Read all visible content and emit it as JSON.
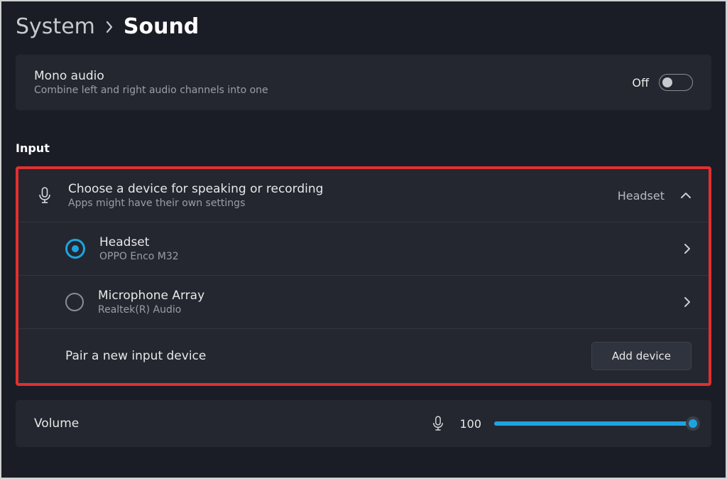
{
  "breadcrumb": {
    "system": "System",
    "sound": "Sound"
  },
  "monoAudio": {
    "title": "Mono audio",
    "sub": "Combine left and right audio channels into one",
    "stateLabel": "Off"
  },
  "inputSection": {
    "label": "Input",
    "header": {
      "title": "Choose a device for speaking or recording",
      "sub": "Apps might have their own settings",
      "current": "Headset"
    },
    "devices": [
      {
        "name": "Headset",
        "driver": "OPPO Enco M32",
        "selected": true
      },
      {
        "name": "Microphone Array",
        "driver": "Realtek(R) Audio",
        "selected": false
      }
    ],
    "pair": {
      "label": "Pair a new input device",
      "button": "Add device"
    }
  },
  "volume": {
    "label": "Volume",
    "value": "100"
  }
}
